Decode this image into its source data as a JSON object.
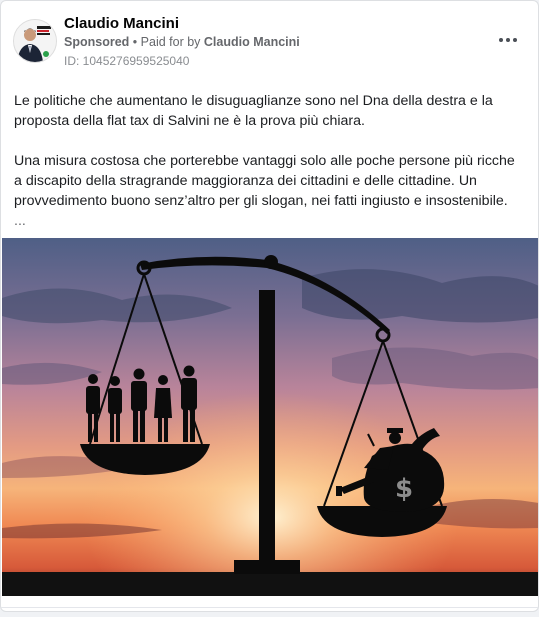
{
  "post": {
    "author": "Claudio Mancini",
    "sponsored_label": "Sponsored",
    "paid_for_prefix": "Paid for by",
    "paid_for_by": "Claudio Mancini",
    "separator": "•",
    "ad_id": "ID: 1045276959525040",
    "paragraph_1": "Le politiche che aumentano le disuguaglianze sono nel Dna della destra e la proposta della flat tax di Salvini ne è la prova più chiara.",
    "paragraph_2": "Una misura costosa che porterebbe vantaggi solo alle poche persone più ricche a discapito della stragrande maggioranza dei cittadini e delle cittadine. Un provvedimento buono senz’altro per gli slogan, nei fatti ingiusto e insostenibile.",
    "see_more": "..."
  },
  "icons": {
    "menu": "more-options-icon",
    "dollar_sign": "$"
  },
  "colors": {
    "author": "#050505",
    "meta": "#65676b",
    "text": "#1c1e21"
  }
}
